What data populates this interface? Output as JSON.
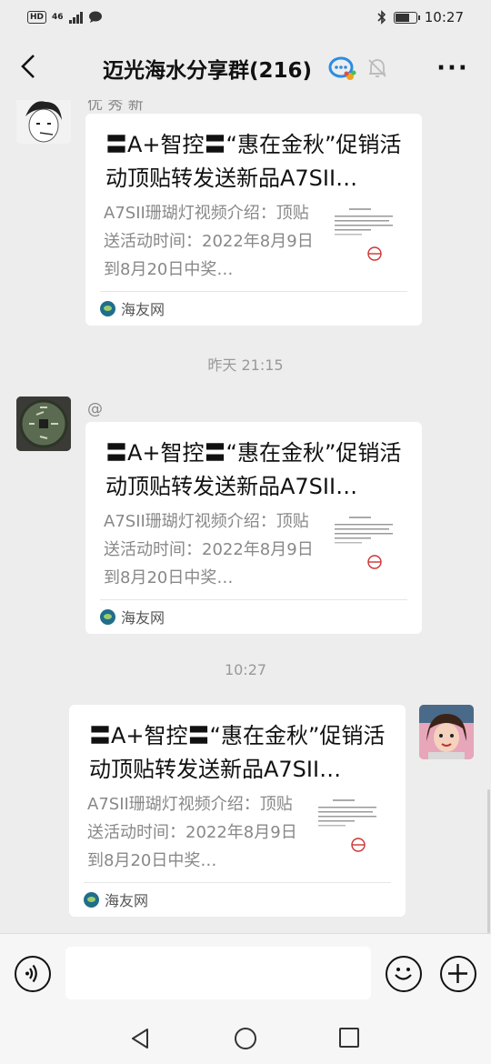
{
  "status_bar": {
    "network": "HD",
    "signal": "46",
    "time": "10:27"
  },
  "header": {
    "title": "迈光海水分享群(216)"
  },
  "messages": [
    {
      "sender": "优 秀 新",
      "card": {
        "title": "〓A+智控〓“惠在金秋”促销活动顶贴转发送新品A7SII…",
        "desc": "A7SII珊瑚灯视频介绍：顶贴送活动时间：2022年8月9日到8月20日中奖…",
        "source": "海友网"
      }
    },
    {
      "timestamp": "昨天 21:15",
      "sender": "@",
      "card": {
        "title": "〓A+智控〓“惠在金秋”促销活动顶贴转发送新品A7SII…",
        "desc": "A7SII珊瑚灯视频介绍：顶贴送活动时间：2022年8月9日到8月20日中奖…",
        "source": "海友网"
      }
    },
    {
      "timestamp": "10:27",
      "card": {
        "title": "〓A+智控〓“惠在金秋”促销活动顶贴转发送新品A7SII…",
        "desc": "A7SII珊瑚灯视频介绍：顶贴送活动时间：2022年8月9日到8月20日中奖…",
        "source": "海友网"
      }
    }
  ],
  "input": {
    "placeholder": ""
  },
  "colors": {
    "background": "#ededed",
    "card": "#ffffff",
    "source_logo": "#1f6e8c"
  },
  "icons": [
    "back-arrow-icon",
    "group-chat-icon",
    "mute-bell-icon",
    "more-icon",
    "voice-icon",
    "emoji-icon",
    "plus-icon"
  ]
}
